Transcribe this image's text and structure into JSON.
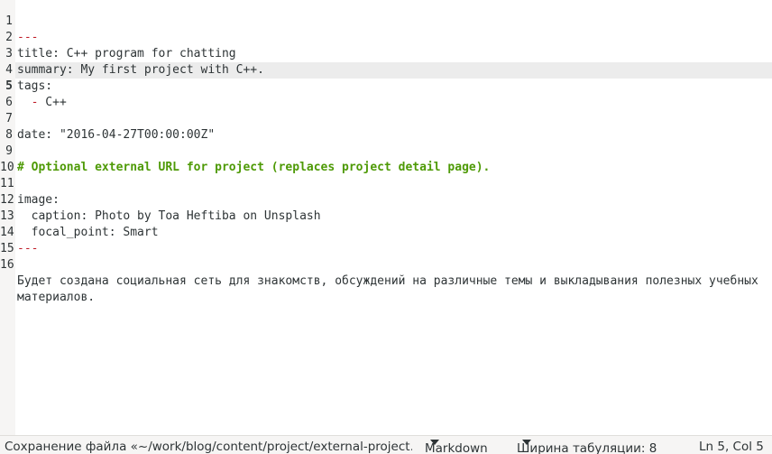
{
  "editor": {
    "lines": [
      {
        "num": "1",
        "code": "",
        "marker": "",
        "rule": "---"
      },
      {
        "num": "2",
        "code": "title: C++ program for chatting"
      },
      {
        "num": "3",
        "code": "summary: My first project with C++."
      },
      {
        "num": "4",
        "code": "tags:"
      },
      {
        "num": "5",
        "code": " C++",
        "marker": "  -"
      },
      {
        "num": "6",
        "code": ""
      },
      {
        "num": "7",
        "code": "date: \"2016-04-27T00:00:00Z\""
      },
      {
        "num": "8",
        "code": ""
      },
      {
        "num": "9",
        "comment": "# Optional external URL for project (replaces project detail page)."
      },
      {
        "num": "10",
        "code": ""
      },
      {
        "num": "11",
        "code": "image:"
      },
      {
        "num": "12",
        "code": "  caption: Photo by Toa Heftiba on Unsplash"
      },
      {
        "num": "13",
        "code": "  focal_point: Smart"
      },
      {
        "num": "14",
        "code": "",
        "rule": "---"
      },
      {
        "num": "15",
        "code": ""
      },
      {
        "num": "16",
        "code": "Будет создана социальная сеть для знакомств, обсуждений на различные темы и выкладывания полезных учебных"
      },
      {
        "num": "",
        "code": "материалов."
      }
    ]
  },
  "statusbar": {
    "message": "Сохранение файла «~/work/blog/content/project/external-project…",
    "language": "Markdown",
    "tab_width": "Ширина табуляции: 8",
    "position": "Ln 5, Col 5"
  }
}
